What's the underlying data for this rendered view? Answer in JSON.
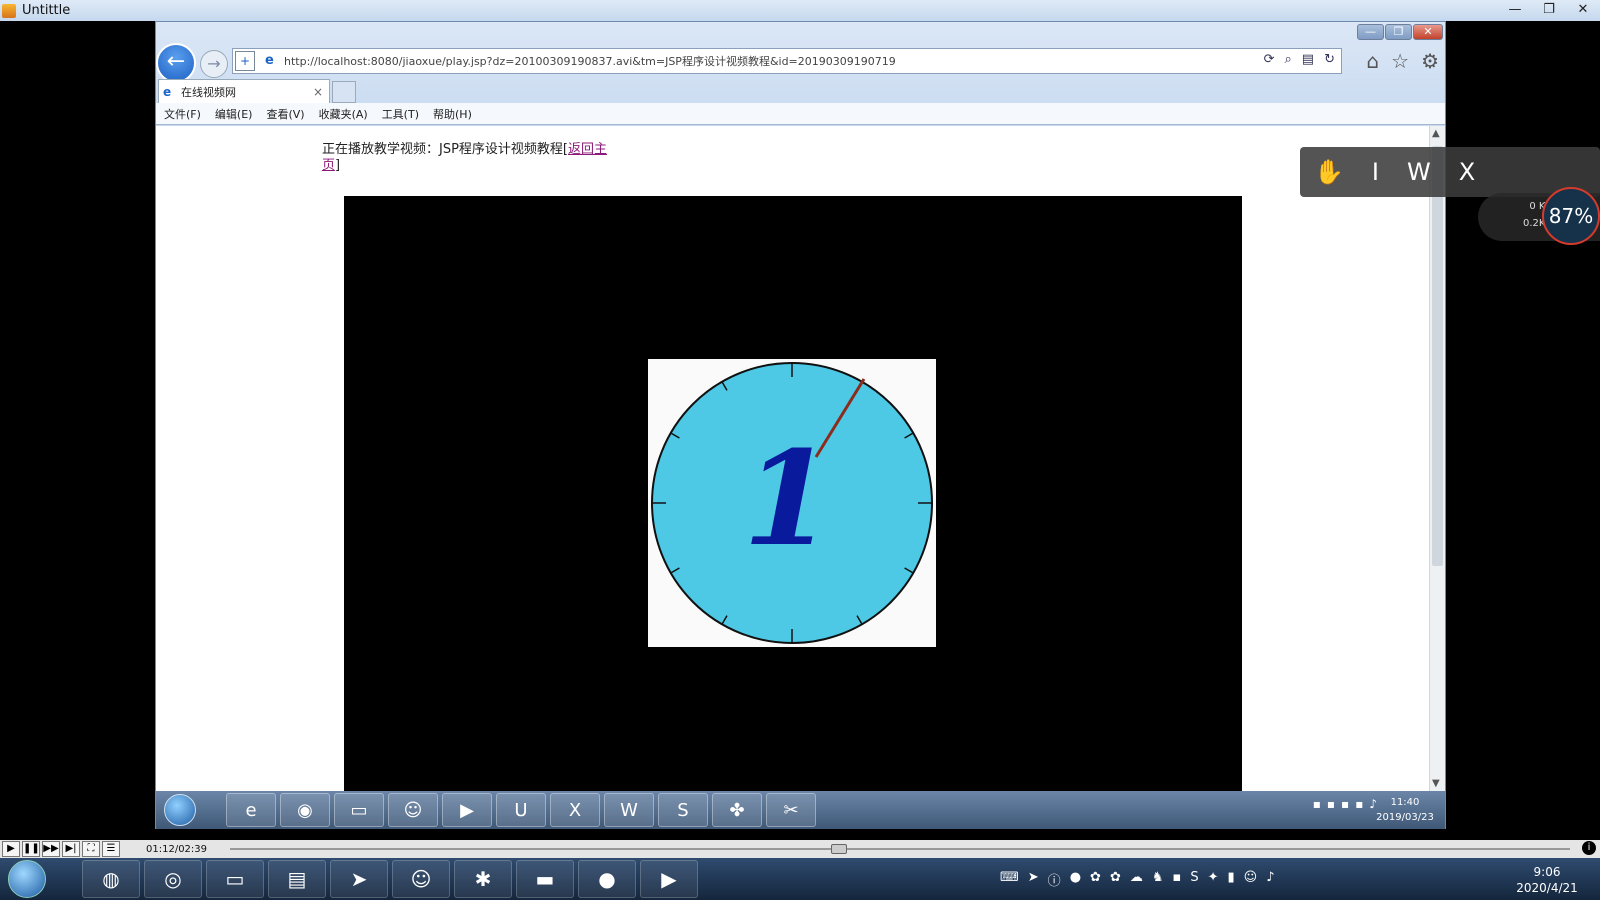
{
  "player": {
    "title": "Untittle",
    "time": "01:12/02:39",
    "buttons": {
      "play": "▶",
      "pause": "❚❚",
      "ffwd": "▶▶",
      "step": "▶|",
      "full": "⛶",
      "menu": "☰"
    },
    "info": "i"
  },
  "browser": {
    "url": "http://localhost:8080/jiaoxue/play.jsp?dz=20100309190837.avi&tm=JSP程序设计视频教程&id=20190309190719",
    "tab_title": "在线视频网",
    "tab_close": "×",
    "menus": [
      "文件(F)",
      "编辑(E)",
      "查看(V)",
      "收藏夹(A)",
      "工具(T)",
      "帮助(H)"
    ]
  },
  "page": {
    "playing_prefix": "正在播放教学视频：JSP程序设计视频教程[",
    "return_link": "返回主页",
    "playing_suffix": "]"
  },
  "clock": {
    "numeral": "1",
    "face_color": "#4dc9e6",
    "numeral_color": "#0a1a9c",
    "hand_color": "#8b2c1c"
  },
  "float_toolbar": {
    "items": [
      "I",
      "W",
      "X"
    ]
  },
  "speed": {
    "up": "0 K/s",
    "down": "0.2K/s",
    "percent": "87%"
  },
  "inner_taskbar": {
    "time": "11:40",
    "date": "2019/03/23"
  },
  "taskbar": {
    "time": "9:06",
    "date": "2020/4/21"
  }
}
